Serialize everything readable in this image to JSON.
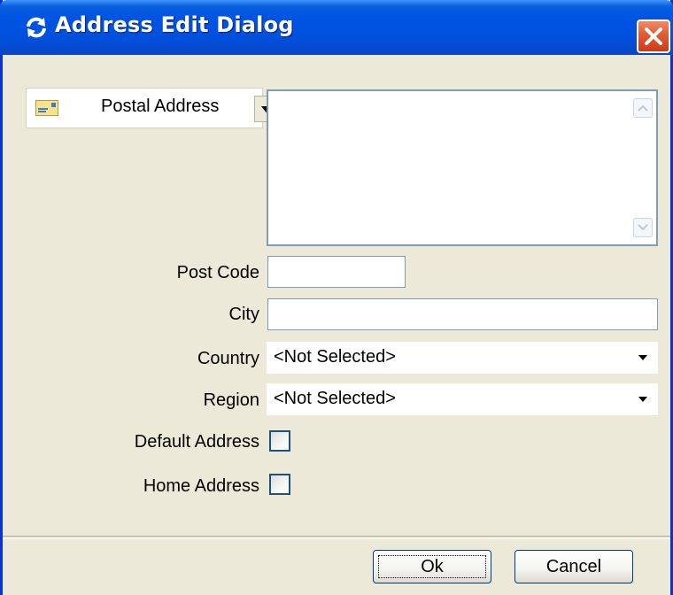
{
  "window": {
    "title": "Address Edit Dialog",
    "title_icon": "refresh-arrows-icon",
    "close_icon": "close-icon",
    "colors": {
      "titlebar": "#0054e3",
      "body": "#ece9d8",
      "close": "#e15a33"
    }
  },
  "address_type": {
    "icon": "envelope-icon",
    "label": "Postal Address"
  },
  "address_text": "",
  "fields": {
    "post_code": {
      "label": "Post Code",
      "value": ""
    },
    "city": {
      "label": "City",
      "value": ""
    },
    "country": {
      "label": "Country",
      "value": "<Not Selected>"
    },
    "region": {
      "label": "Region",
      "value": "<Not Selected>"
    },
    "default_address": {
      "label": "Default Address",
      "checked": false
    },
    "home_address": {
      "label": "Home Address",
      "checked": false
    }
  },
  "buttons": {
    "ok": "Ok",
    "cancel": "Cancel"
  }
}
